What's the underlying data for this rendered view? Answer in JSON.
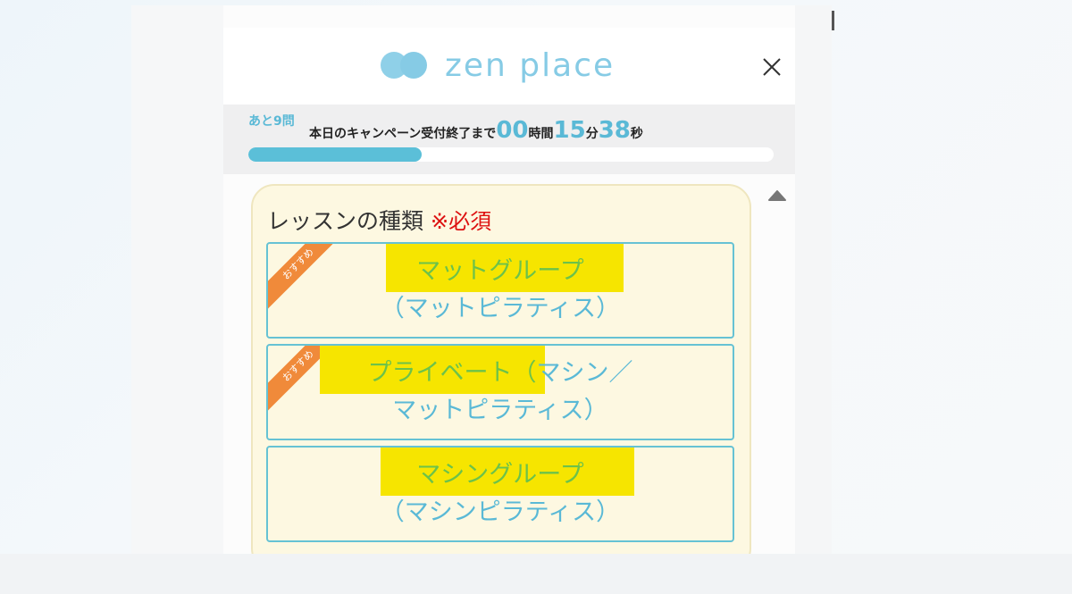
{
  "header": {
    "logo_text": "zen place",
    "close_icon": "close-icon"
  },
  "progress": {
    "remaining_label": "あと9問",
    "countdown_prefix": "本日のキャンペーン受付終了まで",
    "hours": "00",
    "hours_unit": "時間",
    "minutes": "15",
    "minutes_unit": "分",
    "seconds": "38",
    "seconds_unit": "秒",
    "fill_percent": 33
  },
  "question": {
    "title": "レッスンの種類",
    "required_label": "※必須",
    "options": [
      {
        "ribbon": "おすすめ",
        "line1": "マットグループ",
        "line2": "（マットピラティス）"
      },
      {
        "ribbon": "おすすめ",
        "line1_highlighted": "プライベート（",
        "line1_rest": "マシン／",
        "line2": "マットピラティス）"
      },
      {
        "line1": "マシングループ",
        "line2": "（マシンピラティス）"
      }
    ]
  },
  "colors": {
    "accent": "#5ab9d6",
    "card_bg": "#fdf8e1",
    "option_border": "#66c2d4",
    "required": "#dd1111",
    "ribbon": "#f08a3a",
    "highlight": "#f6e500"
  },
  "icons": {
    "scroll_up": "triangle-up-icon"
  }
}
